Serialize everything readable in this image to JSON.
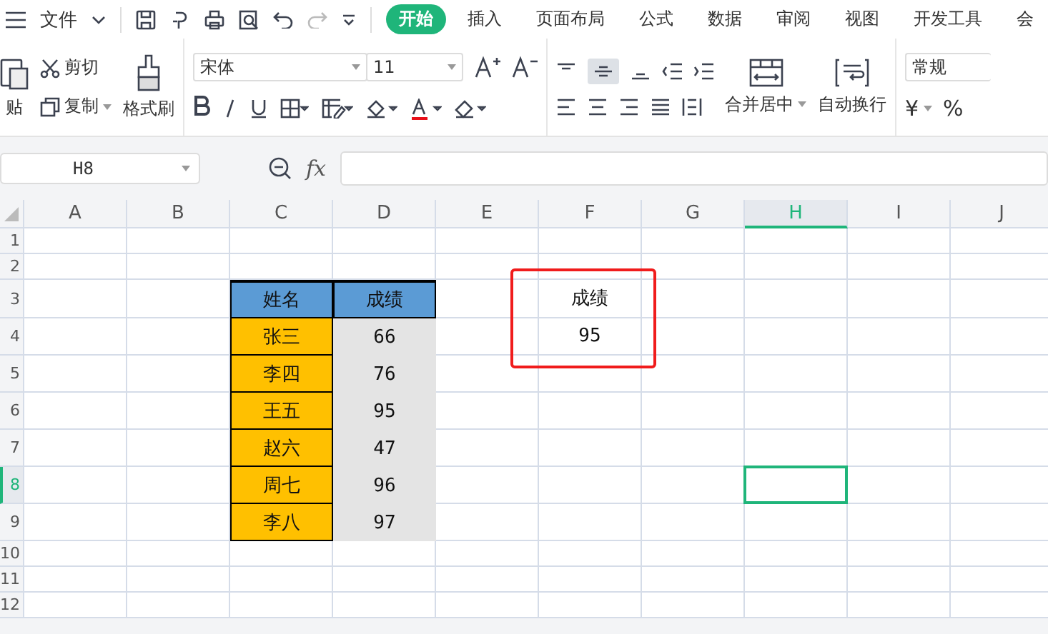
{
  "menu": {
    "file_label": "文件"
  },
  "tabs": [
    {
      "label": "开始",
      "selected": true
    },
    {
      "label": "插入",
      "selected": false
    },
    {
      "label": "页面布局",
      "selected": false
    },
    {
      "label": "公式",
      "selected": false
    },
    {
      "label": "数据",
      "selected": false
    },
    {
      "label": "审阅",
      "selected": false
    },
    {
      "label": "视图",
      "selected": false
    },
    {
      "label": "开发工具",
      "selected": false
    },
    {
      "label": "会",
      "selected": false
    }
  ],
  "ribbon": {
    "paste": "贴",
    "cut": "剪切",
    "copy": "复制",
    "format_painter": "格式刷",
    "font": "宋体",
    "font_size": "11",
    "merge": "合并居中",
    "wrap": "自动换行",
    "number_format": "常规",
    "currency": "¥",
    "percent": "%"
  },
  "formula_bar": {
    "name_box": "H8",
    "fx": "fx"
  },
  "columns": [
    {
      "label": "A",
      "selected": false
    },
    {
      "label": "B",
      "selected": false
    },
    {
      "label": "C",
      "selected": false
    },
    {
      "label": "D",
      "selected": false
    },
    {
      "label": "E",
      "selected": false
    },
    {
      "label": "F",
      "selected": false
    },
    {
      "label": "G",
      "selected": false
    },
    {
      "label": "H",
      "selected": true
    },
    {
      "label": "I",
      "selected": false
    },
    {
      "label": "J",
      "selected": false
    }
  ],
  "rows": [
    {
      "label": "1",
      "selected": false
    },
    {
      "label": "2",
      "selected": false
    },
    {
      "label": "3",
      "selected": false
    },
    {
      "label": "4",
      "selected": false
    },
    {
      "label": "5",
      "selected": false
    },
    {
      "label": "6",
      "selected": false
    },
    {
      "label": "7",
      "selected": false
    },
    {
      "label": "8",
      "selected": true
    },
    {
      "label": "9",
      "selected": false
    },
    {
      "label": "10",
      "selected": false
    },
    {
      "label": "11",
      "selected": false
    },
    {
      "label": "12",
      "selected": false
    }
  ],
  "score_table": {
    "headers": [
      "姓名",
      "成绩"
    ],
    "rows": [
      {
        "name": "张三",
        "score": "66"
      },
      {
        "name": "李四",
        "score": "76"
      },
      {
        "name": "王五",
        "score": "95"
      },
      {
        "name": "赵六",
        "score": "47"
      },
      {
        "name": "周七",
        "score": "96"
      },
      {
        "name": "李八",
        "score": "97"
      }
    ]
  },
  "result_box": {
    "label": "成绩",
    "value": "95"
  }
}
